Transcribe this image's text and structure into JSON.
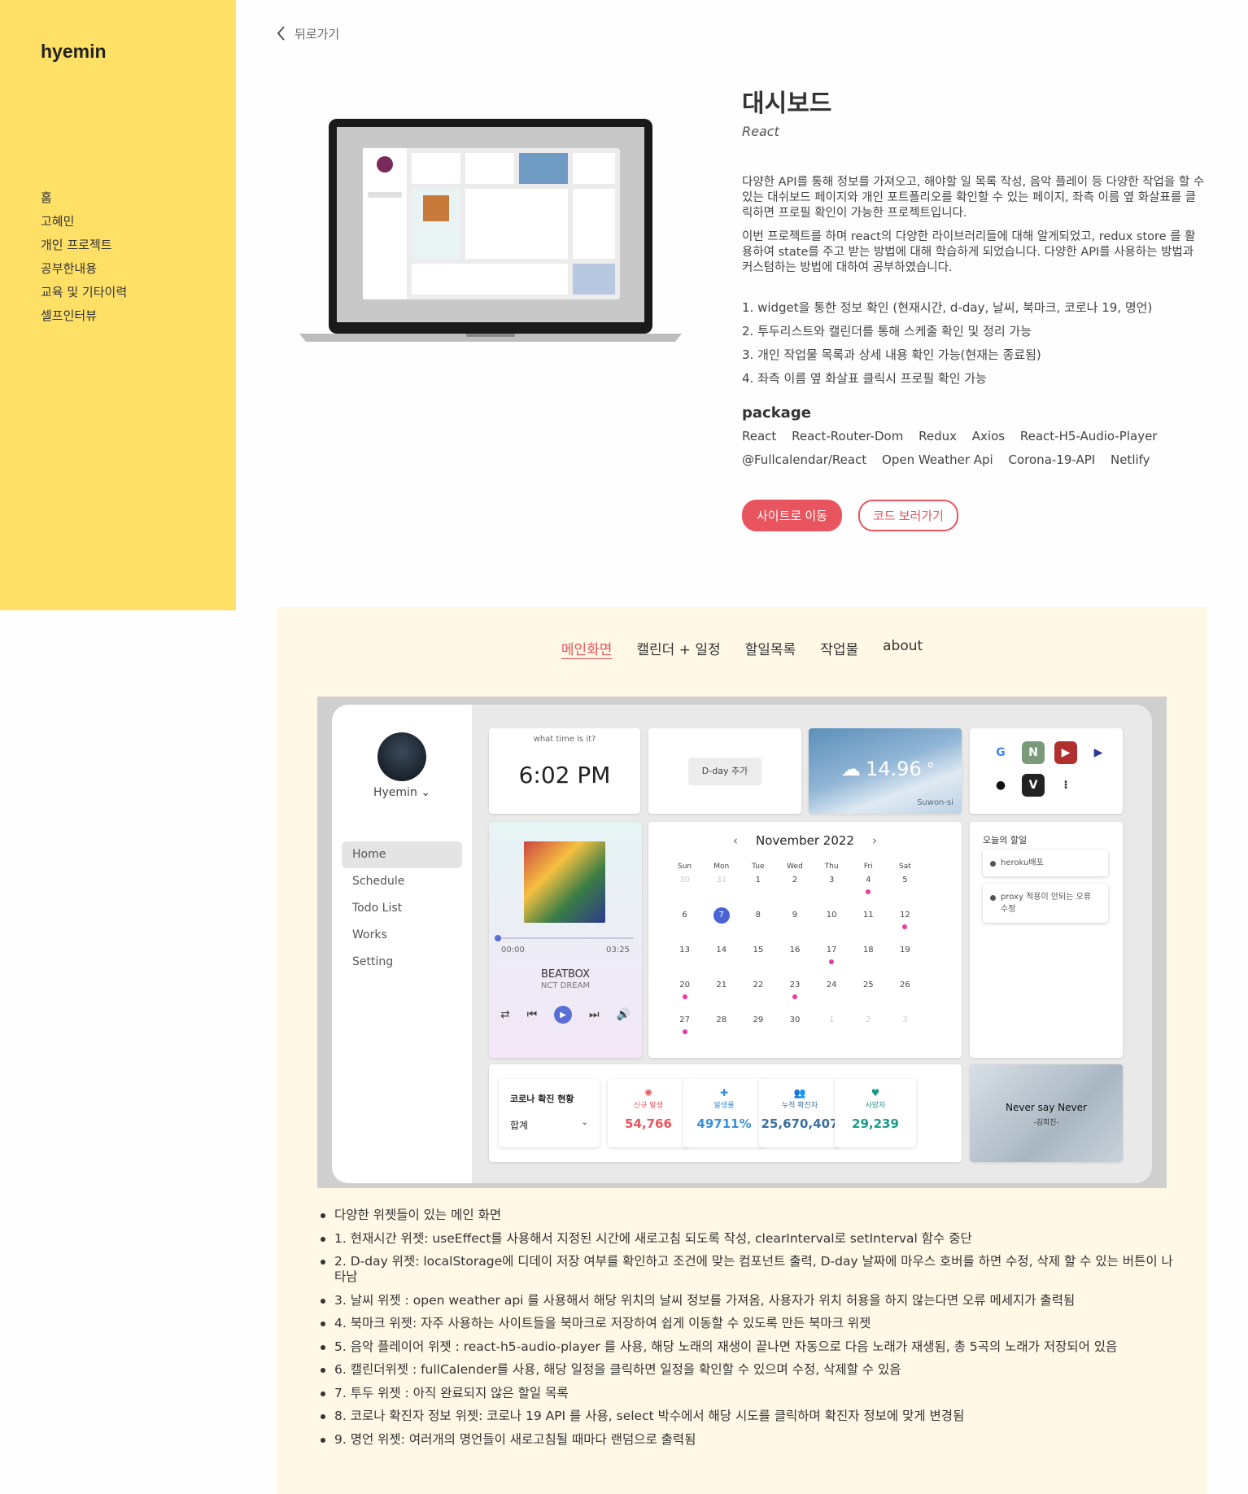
{
  "brand": {
    "logo": "hyemin",
    "accent": "#ffe066",
    "primary": "#e8555e"
  },
  "sidebar": {
    "items": [
      "홈",
      "고혜민",
      "개인 프로젝트",
      "공부한내용",
      "교육 및 기타이력",
      "셀프인터뷰"
    ]
  },
  "back_label": "뒤로가기",
  "project": {
    "title": "대시보드",
    "subtitle": "React",
    "desc1": "다양한 API를 통해 정보를 가져오고, 해야할 일 목록 작성, 음악 플레이 등 다양한 작업을 할 수 있는 대쉬보드 페이지와 개인 포트폴리오를 확인할 수 있는 페이지, 좌측 이름 옆 화살표를 클릭하면 프로필 확인이 가능한 프로젝트입니다.",
    "desc2": "이번 프로젝트를 하며 react의 다양한 라이브러리들에 대해 알게되었고, redux store 를 활용하여 state를 주고 받는 방법에 대해 학습하게 되었습니다. 다양한 API를 사용하는 방법과 커스텀하는 방법에 대하여 공부하였습니다.",
    "features": [
      "1. widget을 통한 정보 확인 (현재시간, d-day, 날씨, 북마크, 코로나 19, 명언)",
      "2. 투두리스트와 캘린더를 통해 스케줄 확인 및 정리 가능",
      "3. 개인 작업물 목록과 상세 내용 확인 가능(현재는 종료됨)",
      "4. 좌측 이름 옆 화살표 클릭시 프로필 확인 가능"
    ],
    "package_title": "package",
    "packages_row1": [
      "React",
      "React-Router-Dom",
      "Redux",
      "Axios",
      "React-H5-Audio-Player"
    ],
    "packages_row2": [
      "@Fullcalendar/React",
      "Open Weather Api",
      "Corona-19-API",
      "Netlify"
    ],
    "btn_site": "사이트로 이동",
    "btn_code": "코드 보러가기"
  },
  "tabs": [
    "메인화면",
    "캘린더 + 일정",
    "할일목록",
    "작업물",
    "about"
  ],
  "active_tab": "메인화면",
  "screenshot": {
    "user": "Hyemin",
    "nav": [
      "Home",
      "Schedule",
      "Todo List",
      "Works",
      "Setting"
    ],
    "time_label": "what time is it?",
    "time": "6:02 PM",
    "dday_btn": "D-day 추가",
    "temp": "14.96",
    "deg": "°",
    "city": "Suwon-si",
    "bookmarks": [
      {
        "icon": "google-icon",
        "glyph": "G",
        "color": "#4285f4",
        "bg": "#fff"
      },
      {
        "icon": "notion-icon",
        "glyph": "N",
        "color": "#fff",
        "bg": "#7a9a7a"
      },
      {
        "icon": "youtube-icon",
        "glyph": "▶",
        "color": "#fff",
        "bg": "#b03030"
      },
      {
        "icon": "play-store-icon",
        "glyph": "▶",
        "color": "#2d3a8c",
        "bg": "#fff"
      },
      {
        "icon": "github-icon",
        "glyph": "●",
        "color": "#111",
        "bg": "#fff"
      },
      {
        "icon": "velog-icon",
        "glyph": "V",
        "color": "#fff",
        "bg": "#222"
      },
      {
        "icon": "more-icon",
        "glyph": "⁝",
        "color": "#333",
        "bg": "#fff"
      }
    ],
    "song": "BEATBOX",
    "artist": "NCT DREAM",
    "t0": "00:00",
    "t1": "03:25",
    "month": "November 2022",
    "dow": [
      "Sun",
      "Mon",
      "Tue",
      "Wed",
      "Thu",
      "Fri",
      "Sat"
    ],
    "calendar": [
      {
        "d": "30",
        "m": true
      },
      {
        "d": "31",
        "m": true
      },
      {
        "d": "1"
      },
      {
        "d": "2"
      },
      {
        "d": "3"
      },
      {
        "d": "4",
        "e": true
      },
      {
        "d": "5"
      },
      {
        "d": "6"
      },
      {
        "d": "7",
        "t": true
      },
      {
        "d": "8"
      },
      {
        "d": "9"
      },
      {
        "d": "10"
      },
      {
        "d": "11"
      },
      {
        "d": "12",
        "e": true
      },
      {
        "d": "13"
      },
      {
        "d": "14"
      },
      {
        "d": "15"
      },
      {
        "d": "16"
      },
      {
        "d": "17",
        "e": true
      },
      {
        "d": "18"
      },
      {
        "d": "19"
      },
      {
        "d": "20",
        "e": true
      },
      {
        "d": "21"
      },
      {
        "d": "22"
      },
      {
        "d": "23",
        "e": true
      },
      {
        "d": "24"
      },
      {
        "d": "25"
      },
      {
        "d": "26"
      },
      {
        "d": "27",
        "e": true
      },
      {
        "d": "28"
      },
      {
        "d": "29"
      },
      {
        "d": "30"
      },
      {
        "d": "1",
        "m": true
      },
      {
        "d": "2",
        "m": true
      },
      {
        "d": "3",
        "m": true
      }
    ],
    "todo_title": "오늘의 할일",
    "todos": [
      "heroku배포",
      "proxy 적용이 안되는 오류 수정"
    ],
    "corona_title": "코로나 확진 현황",
    "corona_select": "합계",
    "stats": [
      {
        "label": "신규 발생",
        "value": "54,766",
        "color": "#e8555e",
        "icon": "virus-icon",
        "glyph": "✺"
      },
      {
        "label": "발생률",
        "value": "49711%",
        "color": "#3a8fd6",
        "icon": "plus-icon",
        "glyph": "✚"
      },
      {
        "label": "누적 확진자",
        "value": "25,670,407",
        "color": "#3a6fa0",
        "icon": "people-icon",
        "glyph": "👥"
      },
      {
        "label": "사망자",
        "value": "29,239",
        "color": "#1a9a8a",
        "icon": "heart-icon",
        "glyph": "♥"
      }
    ],
    "quote": "Never say Never",
    "quote_author": "-김희진-"
  },
  "notes": [
    "다양한 위젯들이 있는 메인 화면",
    "1. 현재시간 위젯: useEffect를 사용해서 지정된 시간에 새로고침 되도록 작성, clearInterval로 setInterval 함수 중단",
    "2. D-day 위젯: localStorage에 디데이 저장 여부를 확인하고 조건에 맞는 컴포넌트 출력, D-day 날짜에 마우스 호버를 하면 수정, 삭제 할 수 있는 버튼이 나타남",
    "3. 날씨 위젯 : open weather api 를 사용해서 해당 위치의 날씨 정보를 가져옴, 사용자가 위치 허용을 하지 않는다면 오류 메세지가 출력됨",
    "4. 북마크 위젯: 자주 사용하는 사이트들을 북마크로 저장하여 쉽게 이동할 수 있도록 만든 북마크 위젯",
    "5. 음악 플레이어 위젯 : react-h5-audio-player 를 사용, 해당 노래의 재생이 끝나면 자동으로 다음 노래가 재생됨, 총 5곡의 노래가 저장되어 있음",
    "6. 캘린더위젯 : fullCalender를 사용, 해당 일정을 클릭하면 일정을 확인할 수 있으며 수정, 삭제할 수 있음",
    "7. 투두 위젯 : 아직 완료되지 않은 할일 목록",
    "8. 코로나 확진자 정보 위젯: 코로나 19 API 를 사용, select 박수에서 해당 시도를 클릭하며 확진자 정보에 맞게 변경됨",
    "9. 명언 위젯: 여러개의 명언들이 새로고침될 때마다 랜덤으로 출력됨"
  ]
}
